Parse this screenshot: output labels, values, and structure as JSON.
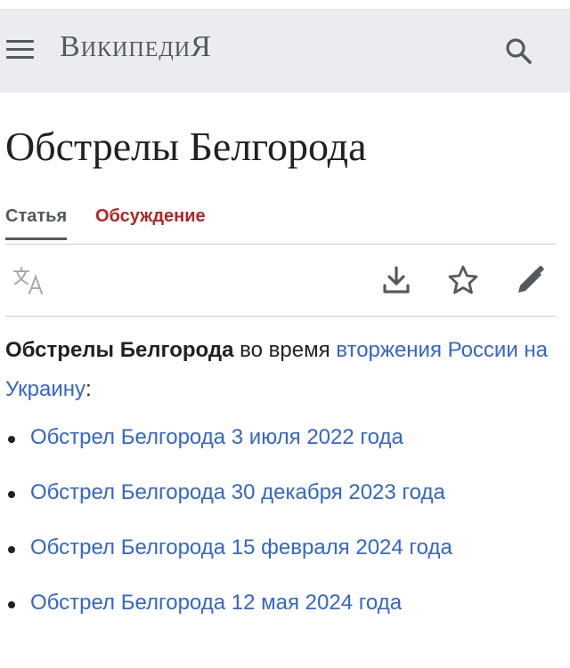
{
  "header": {
    "logo": {
      "initial": "В",
      "rest": "икипеди",
      "final": "Я"
    }
  },
  "article": {
    "title": "Обстрелы Белгорода"
  },
  "tabs": [
    {
      "label": "Статья",
      "active": true
    },
    {
      "label": "Обсуждение",
      "active": false
    }
  ],
  "toolbar": {
    "icons": [
      "language-icon",
      "download-icon",
      "star-icon",
      "edit-icon"
    ]
  },
  "content": {
    "lead_bold": "Обстрелы Белгорода",
    "lead_text": " во время ",
    "lead_link": "вторжения России на Украину",
    "lead_end": ":",
    "links": [
      "Обстрел Белгорода 3 июля 2022 года",
      "Обстрел Белгорода 30 декабря 2023 года",
      "Обстрел Белгорода 15 февраля 2024 года",
      "Обстрел Белгорода 12 мая 2024 года"
    ]
  },
  "colors": {
    "header_bg": "#eaecf0",
    "link": "#3366cc",
    "talk_tab": "#b32424",
    "icon": "#54595d",
    "divider": "#c8ccd1"
  }
}
